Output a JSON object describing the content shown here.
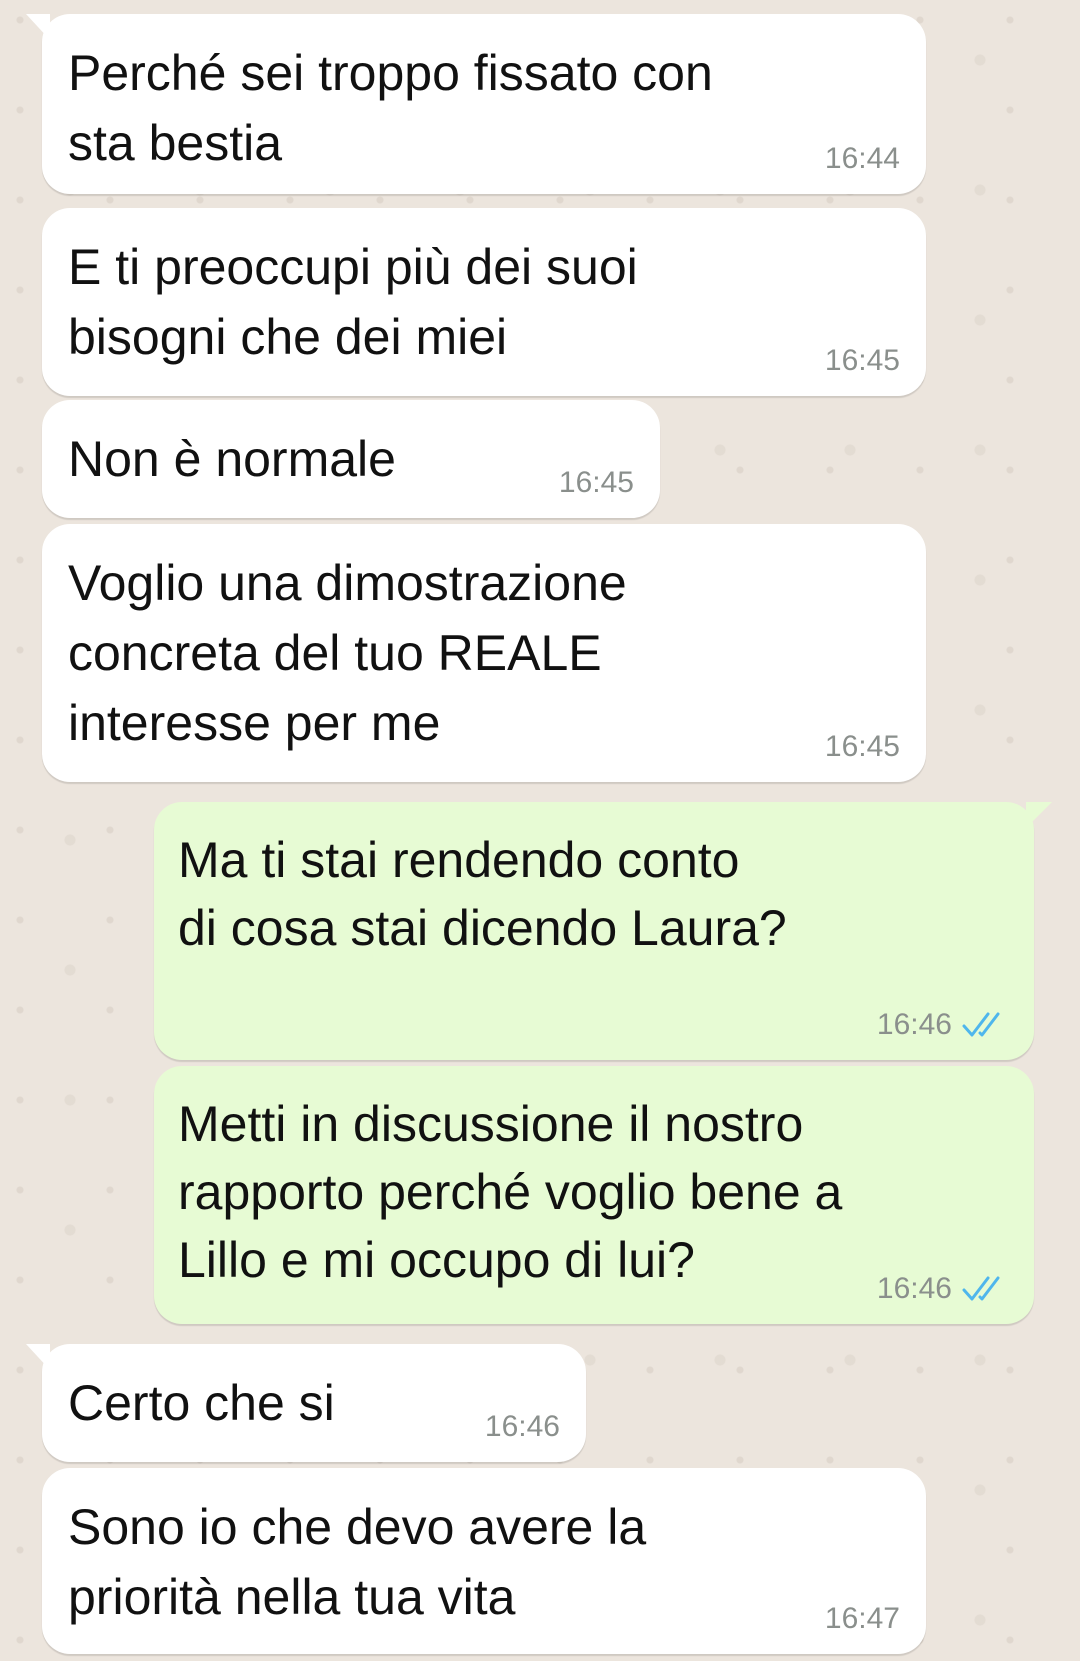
{
  "chat": {
    "messages": [
      {
        "lines": "Perché sei troppo fissato con\nsta bestia",
        "time": "16:44",
        "direction": "incoming"
      },
      {
        "lines": "E ti preoccupi più dei suoi\nbisogni che dei miei",
        "time": "16:45",
        "direction": "incoming"
      },
      {
        "lines": "Non è normale",
        "time": "16:45",
        "direction": "incoming"
      },
      {
        "lines": "Voglio una dimostrazione\nconcreta del tuo REALE\ninteresse per me",
        "time": "16:45",
        "direction": "incoming"
      },
      {
        "lines": "Ma ti stai rendendo conto\ndi cosa stai dicendo Laura?",
        "time": "16:46",
        "direction": "outgoing",
        "status_icon": "double-check-read-icon"
      },
      {
        "lines": "Metti in discussione il nostro\nrapporto perché voglio bene a\nLillo e mi occupo di lui?",
        "time": "16:46",
        "direction": "outgoing",
        "status_icon": "double-check-read-icon"
      },
      {
        "lines": "Certo che si",
        "time": "16:46",
        "direction": "incoming"
      },
      {
        "lines": "Sono io che devo avere la\npriorità nella tua vita",
        "time": "16:47",
        "direction": "incoming"
      }
    ]
  },
  "colors": {
    "background": "#ece5dd",
    "incoming_bubble": "#ffffff",
    "outgoing_bubble": "#e7fbd4",
    "read_ticks": "#4fb6ec",
    "timestamp": "#8a8f8c"
  }
}
